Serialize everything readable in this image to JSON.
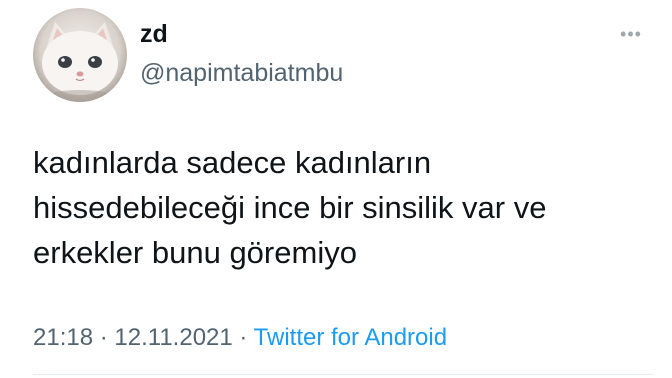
{
  "tweet": {
    "display_name": "zd",
    "handle": "@napimtabiatmbu",
    "more_icon": "more-horizontal-icon",
    "avatar": "cat-avatar",
    "text_lines": [
      "kadınlarda sadece kadınların",
      "hissedebileceği ince bir sinsilik var ve",
      "erkekler bunu göremiyo"
    ],
    "time": "21:18",
    "date": "12.11.2021",
    "source": "Twitter for Android",
    "separator": "·"
  },
  "colors": {
    "text": "#0f1419",
    "secondary": "#536471",
    "link": "#1d9bf0"
  }
}
